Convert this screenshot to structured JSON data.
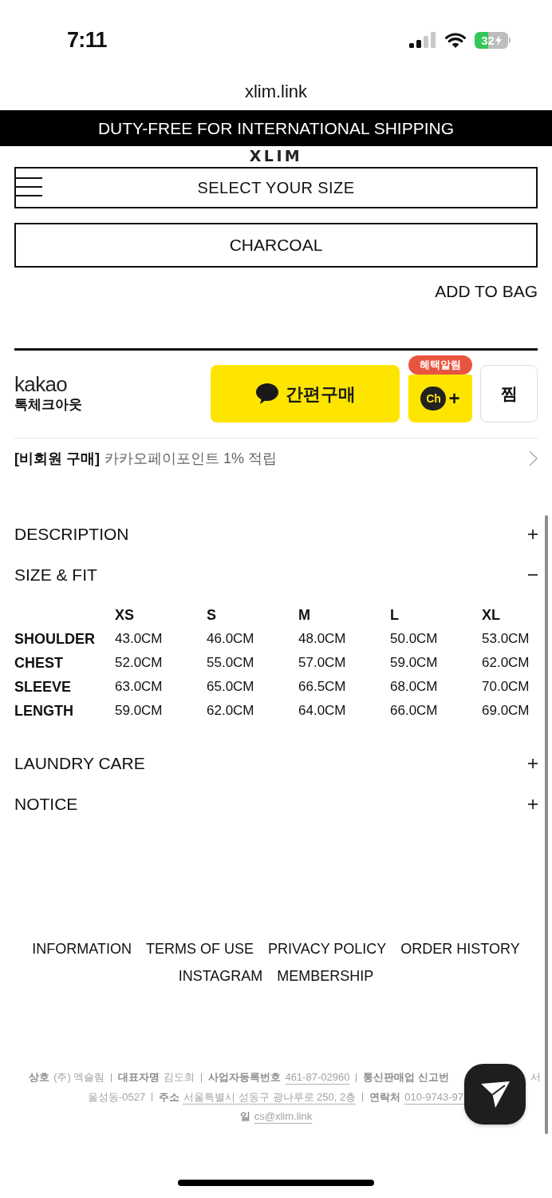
{
  "status_bar": {
    "time": "7:11",
    "battery": "32"
  },
  "browser": {
    "url": "xlim.link"
  },
  "banner": {
    "text": "DUTY-FREE FOR INTERNATIONAL SHIPPING"
  },
  "header": {
    "logo": "XLIM"
  },
  "product_options": {
    "size_select": "SELECT YOUR SIZE",
    "color_select": "CHARCOAL",
    "add_to_bag": "ADD TO BAG"
  },
  "kakao_checkout": {
    "brand": "kakao",
    "title": "톡체크아웃",
    "buy_button": "간편구매",
    "channel_button": {
      "label": "Ch",
      "plus": "+",
      "badge": "혜택알림"
    },
    "wish_button": "찜"
  },
  "member_notice": {
    "tag": "[비회원 구매]",
    "text": "카카오페이포인트 1% 적립"
  },
  "accordion": [
    {
      "title": "DESCRIPTION",
      "expanded": false
    },
    {
      "title": "SIZE & FIT",
      "expanded": true,
      "size_table": {
        "columns": [
          "XS",
          "S",
          "M",
          "L",
          "XL"
        ],
        "rows": [
          {
            "label": "SHOULDER",
            "values": [
              "43.0CM",
              "46.0CM",
              "48.0CM",
              "50.0CM",
              "53.0CM"
            ]
          },
          {
            "label": "CHEST",
            "values": [
              "52.0CM",
              "55.0CM",
              "57.0CM",
              "59.0CM",
              "62.0CM"
            ]
          },
          {
            "label": "SLEEVE",
            "values": [
              "63.0CM",
              "65.0CM",
              "66.5CM",
              "68.0CM",
              "70.0CM"
            ]
          },
          {
            "label": "LENGTH",
            "values": [
              "59.0CM",
              "62.0CM",
              "64.0CM",
              "66.0CM",
              "69.0CM"
            ]
          }
        ]
      }
    },
    {
      "title": "LAUNDRY CARE",
      "expanded": false
    },
    {
      "title": "NOTICE",
      "expanded": false
    }
  ],
  "footer_links": [
    [
      "INFORMATION",
      "TERMS OF USE",
      "PRIVACY POLICY",
      "ORDER HISTORY"
    ],
    [
      "INSTAGRAM",
      "MEMBERSHIP"
    ]
  ],
  "business_info": {
    "lines": [
      [
        {
          "kind": "label",
          "text": "상호"
        },
        {
          "kind": "text",
          "text": "(주) 엑슬림"
        },
        {
          "kind": "divider"
        },
        {
          "kind": "label",
          "text": "대표자명"
        },
        {
          "kind": "text",
          "text": "김도희"
        },
        {
          "kind": "divider"
        },
        {
          "kind": "label",
          "text": "사업자등록번호"
        },
        {
          "kind": "link",
          "text": "461-87-02960"
        },
        {
          "kind": "divider"
        },
        {
          "kind": "label",
          "text": "통신판매업 신고번"
        },
        {
          "kind": "covered"
        },
        {
          "kind": "text",
          "text": "서"
        }
      ],
      [
        {
          "kind": "text",
          "text": "울성동-0527"
        },
        {
          "kind": "divider"
        },
        {
          "kind": "label",
          "text": "주소"
        },
        {
          "kind": "address",
          "text": "서울특별시 성동구 광나루로 250, 2층"
        },
        {
          "kind": "divider"
        },
        {
          "kind": "label",
          "text": "연락처"
        },
        {
          "kind": "link",
          "text": "010-9743-97"
        },
        {
          "kind": "covered"
        }
      ],
      [
        {
          "kind": "label",
          "text": "일"
        },
        {
          "kind": "link",
          "text": "cs@xlim.link"
        }
      ]
    ]
  }
}
